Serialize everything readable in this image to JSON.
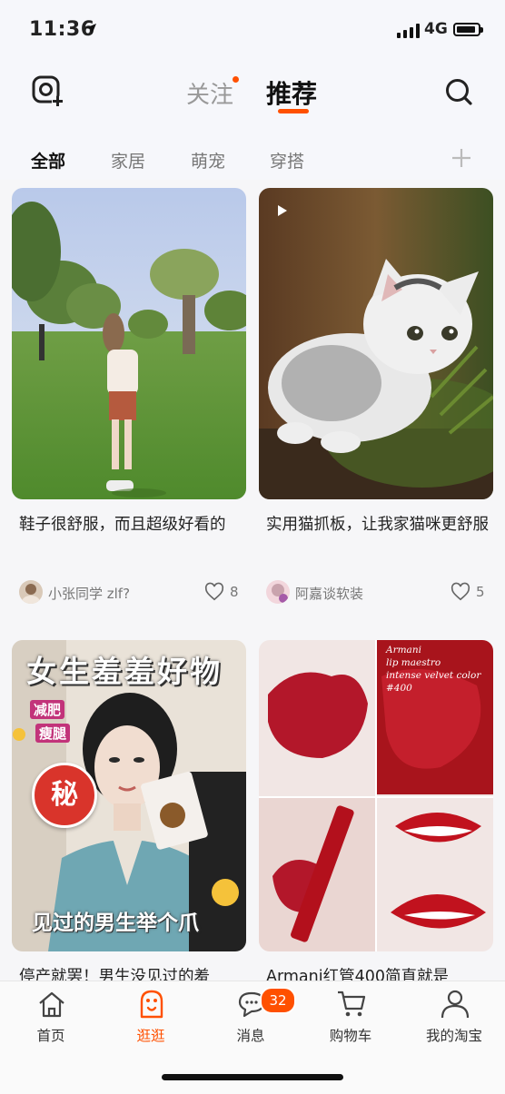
{
  "status_bar": {
    "time": "11:36",
    "network": "4G"
  },
  "top_nav": {
    "tabs": [
      {
        "label": "关注",
        "has_dot": true
      },
      {
        "label": "推荐",
        "active": true
      }
    ],
    "icons": [
      "camera-plus-icon",
      "search-icon"
    ]
  },
  "categories": {
    "items": [
      "全部",
      "家居",
      "萌宠",
      "穿搭"
    ],
    "active": "全部"
  },
  "feed": [
    {
      "title": "鞋子很舒服，而且超级好看的",
      "author": "小张同学 zlf?",
      "likes": "8",
      "image": "photo-girl-in-park"
    },
    {
      "title": "实用猫抓板，让我家猫咪更舒服",
      "author": "阿嘉谈软装",
      "likes": "5",
      "image": "video-kitten",
      "is_video": true
    },
    {
      "title": "停产就罢！男生没见过的羞",
      "image": "photo-woman-holding-product",
      "overlay": {
        "headline": "女生羞羞好物",
        "bottom": "见过的男生举个爪",
        "badge": "秘",
        "stickers": [
          "减肥",
          "瘦腿"
        ]
      }
    },
    {
      "title": "Armani红管400简直就是",
      "image": "photo-lipstick-swatches",
      "overlay": {
        "lines": [
          "Armani",
          "lip maestro",
          "intense velvet color",
          "#400"
        ]
      }
    }
  ],
  "tab_bar": {
    "items": [
      {
        "label": "首页",
        "icon": "home-icon"
      },
      {
        "label": "逛逛",
        "icon": "browse-icon",
        "active": true
      },
      {
        "label": "消息",
        "icon": "message-icon",
        "badge": "32"
      },
      {
        "label": "购物车",
        "icon": "cart-icon"
      },
      {
        "label": "我的淘宝",
        "icon": "profile-icon"
      }
    ]
  },
  "colors": {
    "accent": "#ff5000",
    "background": "#f6f7fb"
  }
}
